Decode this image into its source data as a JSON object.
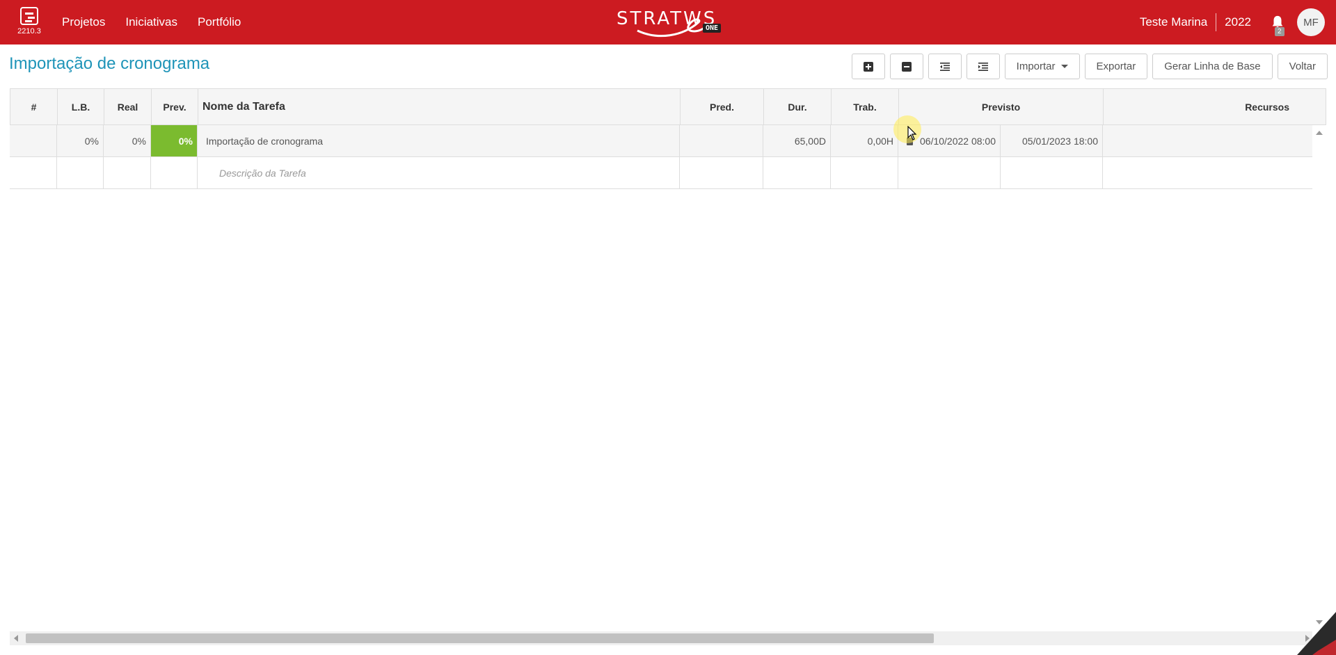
{
  "app": {
    "version": "2210.3",
    "logo_text": "STRATWS",
    "logo_badge": "ONE"
  },
  "nav": {
    "items": [
      {
        "label": "Projetos"
      },
      {
        "label": "Iniciativas"
      },
      {
        "label": "Portfólio"
      }
    ]
  },
  "user": {
    "name": "Teste Marina",
    "year": "2022",
    "notifications": "2",
    "initials": "MF"
  },
  "page": {
    "title": "Importação de cronograma"
  },
  "toolbar": {
    "importar": "Importar",
    "exportar": "Exportar",
    "baseline": "Gerar Linha de Base",
    "voltar": "Voltar"
  },
  "table": {
    "headers": {
      "num": "#",
      "lb": "L.B.",
      "real": "Real",
      "prev": "Prev.",
      "name": "Nome da Tarefa",
      "pred": "Pred.",
      "dur": "Dur.",
      "trab": "Trab.",
      "previsto": "Previsto",
      "recursos": "Recursos"
    },
    "rows": [
      {
        "num": "",
        "lb": "0%",
        "real": "0%",
        "prev": "0%",
        "name": "Importação de cronograma",
        "pred": "",
        "dur": "65,00D",
        "trab": "0,00H",
        "start": "06/10/2022 08:00",
        "end": "05/01/2023 18:00",
        "recursos": ""
      }
    ],
    "placeholder_row": {
      "name": "Descrição da Tarefa"
    }
  },
  "colors": {
    "topbar": "#cc1b21",
    "title": "#1e94b8",
    "progress": "#7bbb2f"
  }
}
